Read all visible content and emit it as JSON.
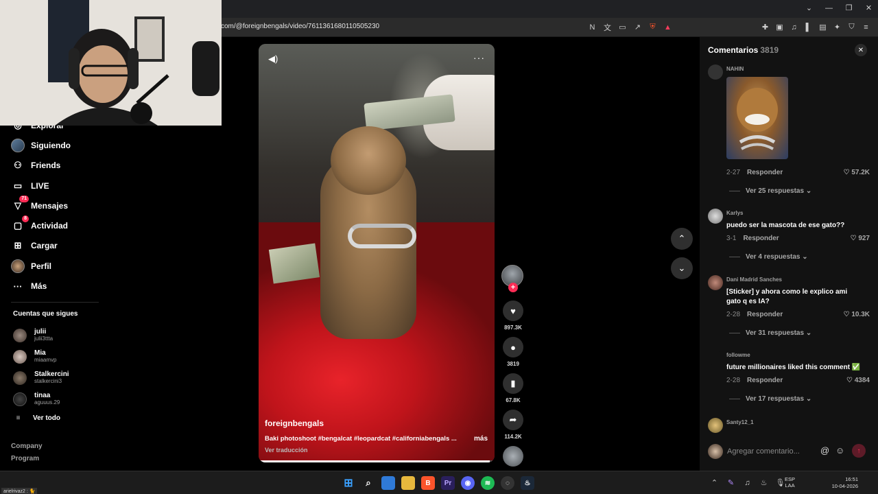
{
  "browser": {
    "url": "com/@foreignbengals/video/7611361680110505230"
  },
  "sidebar": {
    "nav": [
      {
        "label": "Explorar",
        "icon": "compass-icon",
        "badge": ""
      },
      {
        "label": "Siguiendo",
        "icon": "following-avatar-icon",
        "badge": ""
      },
      {
        "label": "Friends",
        "icon": "friends-icon",
        "badge": ""
      },
      {
        "label": "LIVE",
        "icon": "live-icon",
        "badge": ""
      },
      {
        "label": "Mensajes",
        "icon": "messages-icon",
        "badge": "71"
      },
      {
        "label": "Actividad",
        "icon": "activity-icon",
        "badge": "8"
      },
      {
        "label": "Cargar",
        "icon": "upload-icon",
        "badge": ""
      },
      {
        "label": "Perfil",
        "icon": "profile-avatar-icon",
        "badge": ""
      },
      {
        "label": "Más",
        "icon": "more-icon",
        "badge": ""
      }
    ],
    "following_title": "Cuentas que sigues",
    "following": [
      {
        "name": "julii",
        "handle": "julii3ttta"
      },
      {
        "name": "Mia",
        "handle": "miaamvp"
      },
      {
        "name": "Stalkercini",
        "handle": "stalkercini3"
      },
      {
        "name": "tinaa",
        "handle": "aguuus.29"
      }
    ],
    "see_all": "Ver todo",
    "footer": [
      "Company",
      "Program"
    ]
  },
  "video": {
    "author": "foreignbengals",
    "description": "Baki photoshoot #bengalcat #leopardcat #californiabengals ...",
    "more": "más",
    "translate": "Ver traducción",
    "progress": 0.98
  },
  "actions": {
    "likes": "897.3K",
    "comments": "3819",
    "saves": "67.8K",
    "shares": "114.2K"
  },
  "comments": {
    "title": "Comentarios",
    "count": "3819",
    "reply_label": "Responder",
    "items": [
      {
        "user": "NAHIN",
        "text": "",
        "date": "2-27",
        "likes": "57.2K",
        "replies": "Ver 25 respuestas"
      },
      {
        "user": "Karlys",
        "text": "puedo ser la mascota de ese gato??",
        "date": "3-1",
        "likes": "927",
        "replies": "Ver 4 respuestas"
      },
      {
        "user": "Dani Madrid Sanches",
        "text": "[Sticker] y ahora como le explico ami gato q es IA?",
        "date": "2-28",
        "likes": "10.3K",
        "replies": "Ver 31 respuestas"
      },
      {
        "user": "followme",
        "text": "future millionaires liked this comment ✅",
        "date": "2-28",
        "likes": "4384",
        "replies": "Ver 17 respuestas"
      },
      {
        "user": "Santy12_1",
        "text": "",
        "date": "",
        "likes": "",
        "replies": ""
      }
    ],
    "input_placeholder": "Agregar comentario..."
  },
  "taskbar": {
    "lang_top": "ESP",
    "lang_bottom": "LAA",
    "time": "16:51",
    "date": "10-04-2026",
    "status_text": "arielrivaz2 : 🐈"
  },
  "colors": {
    "accent": "#fe2c55",
    "panel": "#121212"
  }
}
